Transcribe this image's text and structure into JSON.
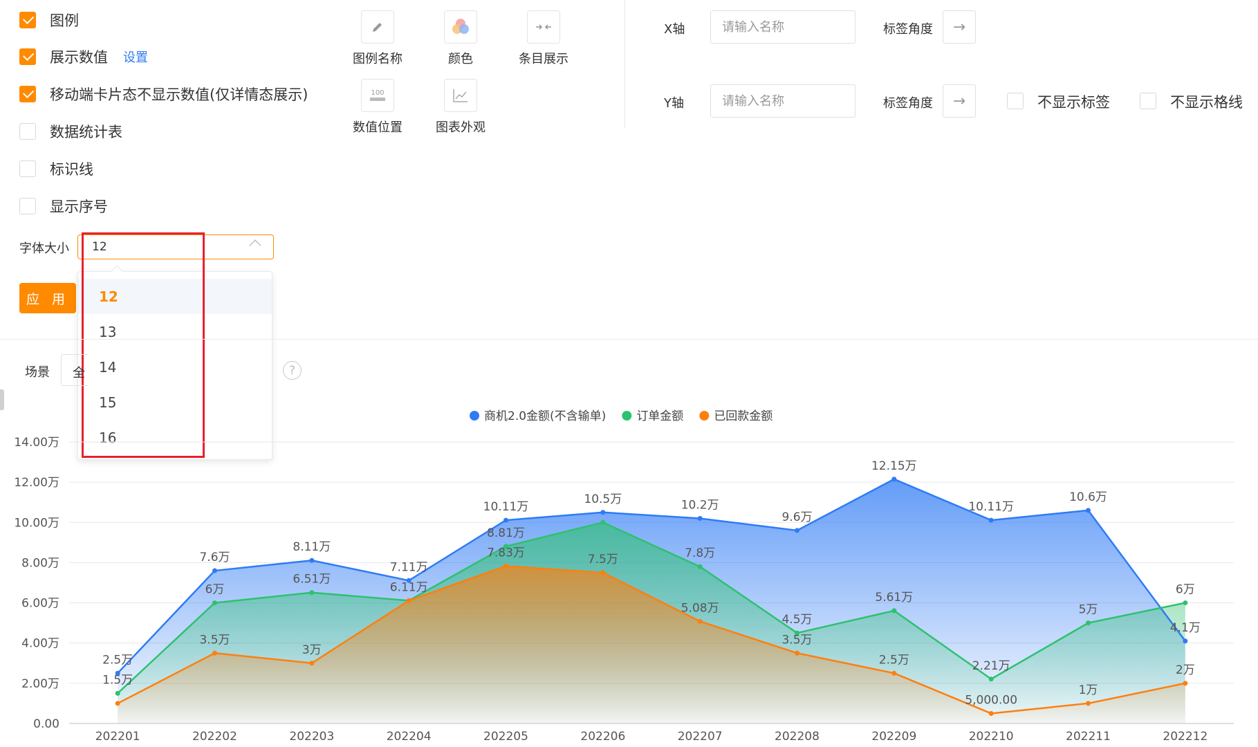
{
  "options": [
    {
      "label": "图例",
      "checked": true
    },
    {
      "label": "展示数值",
      "checked": true,
      "link": "设置"
    },
    {
      "label": "移动端卡片态不显示数值(仅详情态展示)",
      "checked": true
    },
    {
      "label": "数据统计表",
      "checked": false
    },
    {
      "label": "标识线",
      "checked": false
    },
    {
      "label": "显示序号",
      "checked": false
    }
  ],
  "font_size": {
    "label": "字体大小",
    "value": "12",
    "options": [
      "12",
      "13",
      "14",
      "15",
      "16"
    ],
    "selected": "12"
  },
  "apply_label": "应 用",
  "tools": [
    {
      "label": "图例名称",
      "icon": "pencil-icon"
    },
    {
      "label": "颜色",
      "icon": "color-palette-icon"
    },
    {
      "label": "条目展示",
      "icon": "collapse-arrows-icon"
    },
    {
      "label": "数值位置",
      "icon": "value-position-icon"
    },
    {
      "label": "图表外观",
      "icon": "chart-appearance-icon"
    }
  ],
  "x_axis": {
    "label": "X轴",
    "placeholder": "请输入名称",
    "angle_label": "标签角度"
  },
  "y_axis": {
    "label": "Y轴",
    "placeholder": "请输入名称",
    "angle_label": "标签角度",
    "hide_labels": "不显示标签",
    "hide_grid": "不显示格线"
  },
  "scene": {
    "label": "场景",
    "value": "全"
  },
  "colors": {
    "accent": "#ff8a00",
    "blue": "#2f7bf5",
    "green": "#2ec16e",
    "orange": "#ff7f0e",
    "selection_box": "#e8202e"
  },
  "chart_data": {
    "type": "area",
    "categories": [
      "202201",
      "202202",
      "202203",
      "202204",
      "202205",
      "202206",
      "202207",
      "202208",
      "202209",
      "202210",
      "202211",
      "202212"
    ],
    "ylim": [
      0,
      140000
    ],
    "yticks": [
      "0.00",
      "2.00万",
      "4.00万",
      "6.00万",
      "8.00万",
      "10.00万",
      "12.00万",
      "14.00万"
    ],
    "grid": true,
    "legend_position": "top-center",
    "series": [
      {
        "name": "商机2.0金额(不含输单)",
        "color": "#2f7bf5",
        "values": [
          25000,
          76000,
          81100,
          71100,
          101100,
          105000,
          102000,
          96000,
          121500,
          101100,
          106000,
          41000
        ],
        "labels": [
          "2.5万",
          "7.6万",
          "8.11万",
          "7.11万",
          "10.11万",
          "10.5万",
          "10.2万",
          "9.6万",
          "12.15万",
          "10.11万",
          "10.6万",
          "4.1万"
        ]
      },
      {
        "name": "订单金额",
        "color": "#2ec16e",
        "values": [
          15000,
          60000,
          65100,
          61100,
          88100,
          100000,
          78000,
          45000,
          56100,
          22100,
          50000,
          60000
        ],
        "labels": [
          "1.5万",
          "6万",
          "6.51万",
          "6.11万",
          "8.81万",
          "",
          "7.8万",
          "4.5万",
          "5.61万",
          "2.21万",
          "5万",
          "6万"
        ]
      },
      {
        "name": "已回款金额",
        "color": "#ff7f0e",
        "values": [
          10000,
          35000,
          30000,
          61100,
          78300,
          75000,
          50800,
          35000,
          25000,
          5000,
          10000,
          20000
        ],
        "labels": [
          "",
          "3.5万",
          "3万",
          "",
          "7.83万",
          "7.5万",
          "5.08万",
          "3.5万",
          "2.5万",
          "5,000.00",
          "1万",
          "2万"
        ]
      }
    ]
  }
}
